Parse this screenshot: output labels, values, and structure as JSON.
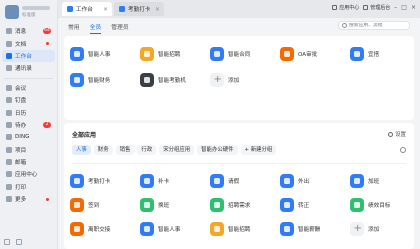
{
  "sidebar": {
    "profile_sub": "标准版",
    "items": [
      {
        "label": "消息",
        "badge": "64"
      },
      {
        "label": "文档",
        "dot": true
      },
      {
        "label": "工作台",
        "active": true
      },
      {
        "label": "通讯录"
      },
      {
        "label": "会议"
      },
      {
        "label": "钉盘"
      },
      {
        "label": "日历"
      },
      {
        "label": "待办",
        "badge": "2"
      },
      {
        "label": "DING"
      },
      {
        "label": "项目"
      },
      {
        "label": "邮箱"
      },
      {
        "label": "应用中心"
      },
      {
        "label": "打印"
      },
      {
        "label": "更多",
        "dot": true
      }
    ]
  },
  "topbar": {
    "tabs": [
      "工作台",
      "考勤打卡"
    ],
    "links": [
      "应用中心",
      "管理后台"
    ]
  },
  "main": {
    "sub_tabs": [
      "常用",
      "全员",
      "管理员"
    ],
    "search_placeholder": "搜索应用、流程"
  },
  "common_apps": [
    {
      "label": "智能人事",
      "color": "#2f7cf6"
    },
    {
      "label": "智能招聘",
      "color": "#f5a623"
    },
    {
      "label": "智能合同",
      "color": "#2f7cf6"
    },
    {
      "label": "OA审批",
      "color": "#f56a00"
    },
    {
      "label": "宜搭",
      "color": "#2f7cf6"
    },
    {
      "label": "智能财务",
      "color": "#2f7cf6"
    },
    {
      "label": "智能考勤机",
      "color": "#3a3f46"
    },
    {
      "label": "添加",
      "add": true
    }
  ],
  "all_apps": {
    "title": "全部应用",
    "settings": "设置",
    "chips": [
      "人事",
      "财务",
      "销售",
      "行政",
      "宋分组应用",
      "智能办公硬件",
      "+ 新建分组"
    ],
    "apps": [
      {
        "label": "考勤打卡",
        "color": "#2f7cf6"
      },
      {
        "label": "补卡",
        "color": "#2f7cf6"
      },
      {
        "label": "请假",
        "color": "#2f7cf6"
      },
      {
        "label": "外出",
        "color": "#2f7cf6"
      },
      {
        "label": "加班",
        "color": "#2f7cf6"
      },
      {
        "label": "签到",
        "color": "#f56a00"
      },
      {
        "label": "换班",
        "color": "#2fbf71"
      },
      {
        "label": "招聘需求",
        "color": "#2fbf71"
      },
      {
        "label": "转正",
        "color": "#2f7cf6"
      },
      {
        "label": "绩效目标",
        "color": "#2fbf71"
      },
      {
        "label": "离职交接",
        "color": "#f56a00"
      },
      {
        "label": "智能人事",
        "color": "#2f7cf6"
      },
      {
        "label": "智能招聘",
        "color": "#f5a623"
      },
      {
        "label": "智能薪酬",
        "color": "#2f7cf6"
      },
      {
        "label": "添加",
        "add": true
      }
    ]
  }
}
